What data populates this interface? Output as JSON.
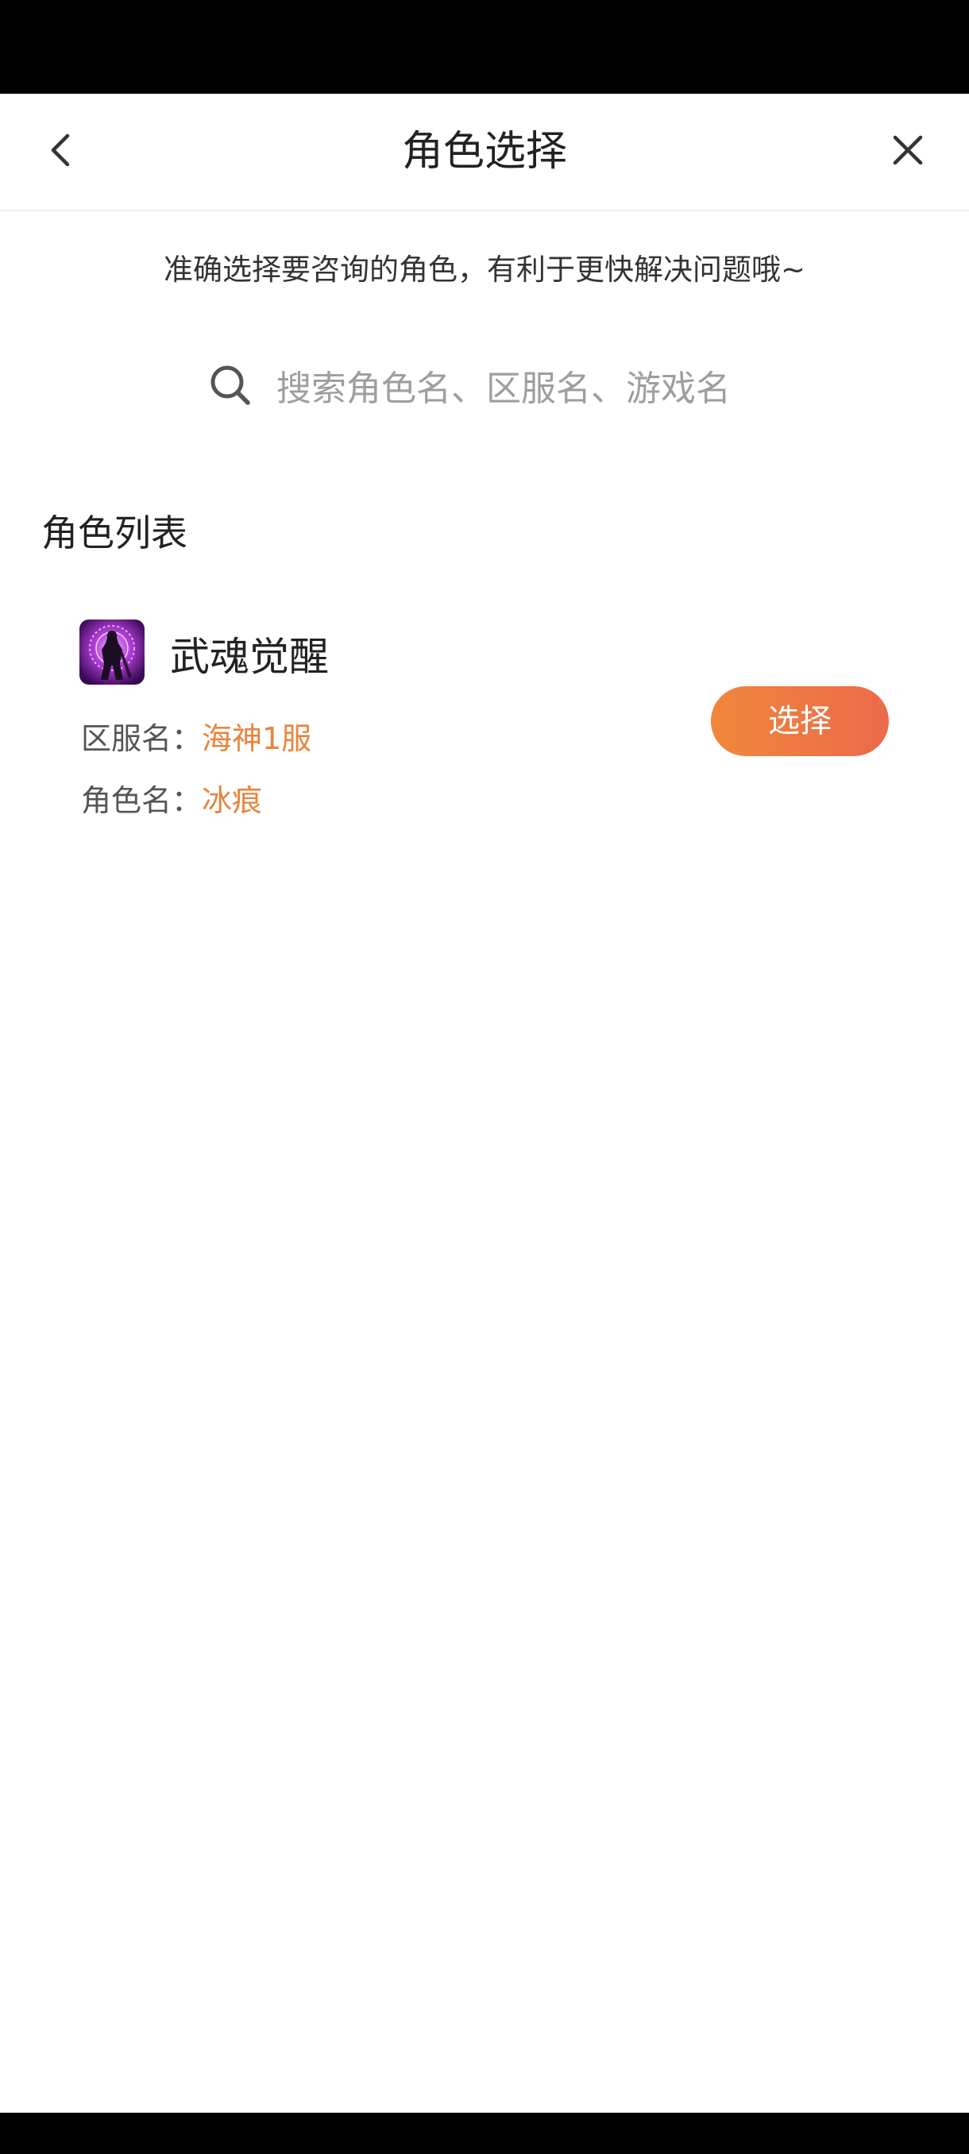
{
  "header": {
    "title": "角色选择"
  },
  "hint": "准确选择要咨询的角色，有利于更快解决问题哦~",
  "search": {
    "placeholder": "搜索角色名、区服名、游戏名"
  },
  "section": {
    "title": "角色列表"
  },
  "roles": [
    {
      "game": "武魂觉醒",
      "server_label": "区服名：",
      "server": "海神1服",
      "role_label": "角色名：",
      "role": "冰痕",
      "action_label": "选择",
      "icon": "game-avatar-icon"
    }
  ],
  "colors": {
    "accent": "#e8843e",
    "button_start": "#f0873a",
    "button_end": "#ec6a4b",
    "status_bar": "#000000"
  },
  "icons": {
    "back": "chevron-left-icon",
    "close": "close-icon",
    "search": "search-icon"
  }
}
